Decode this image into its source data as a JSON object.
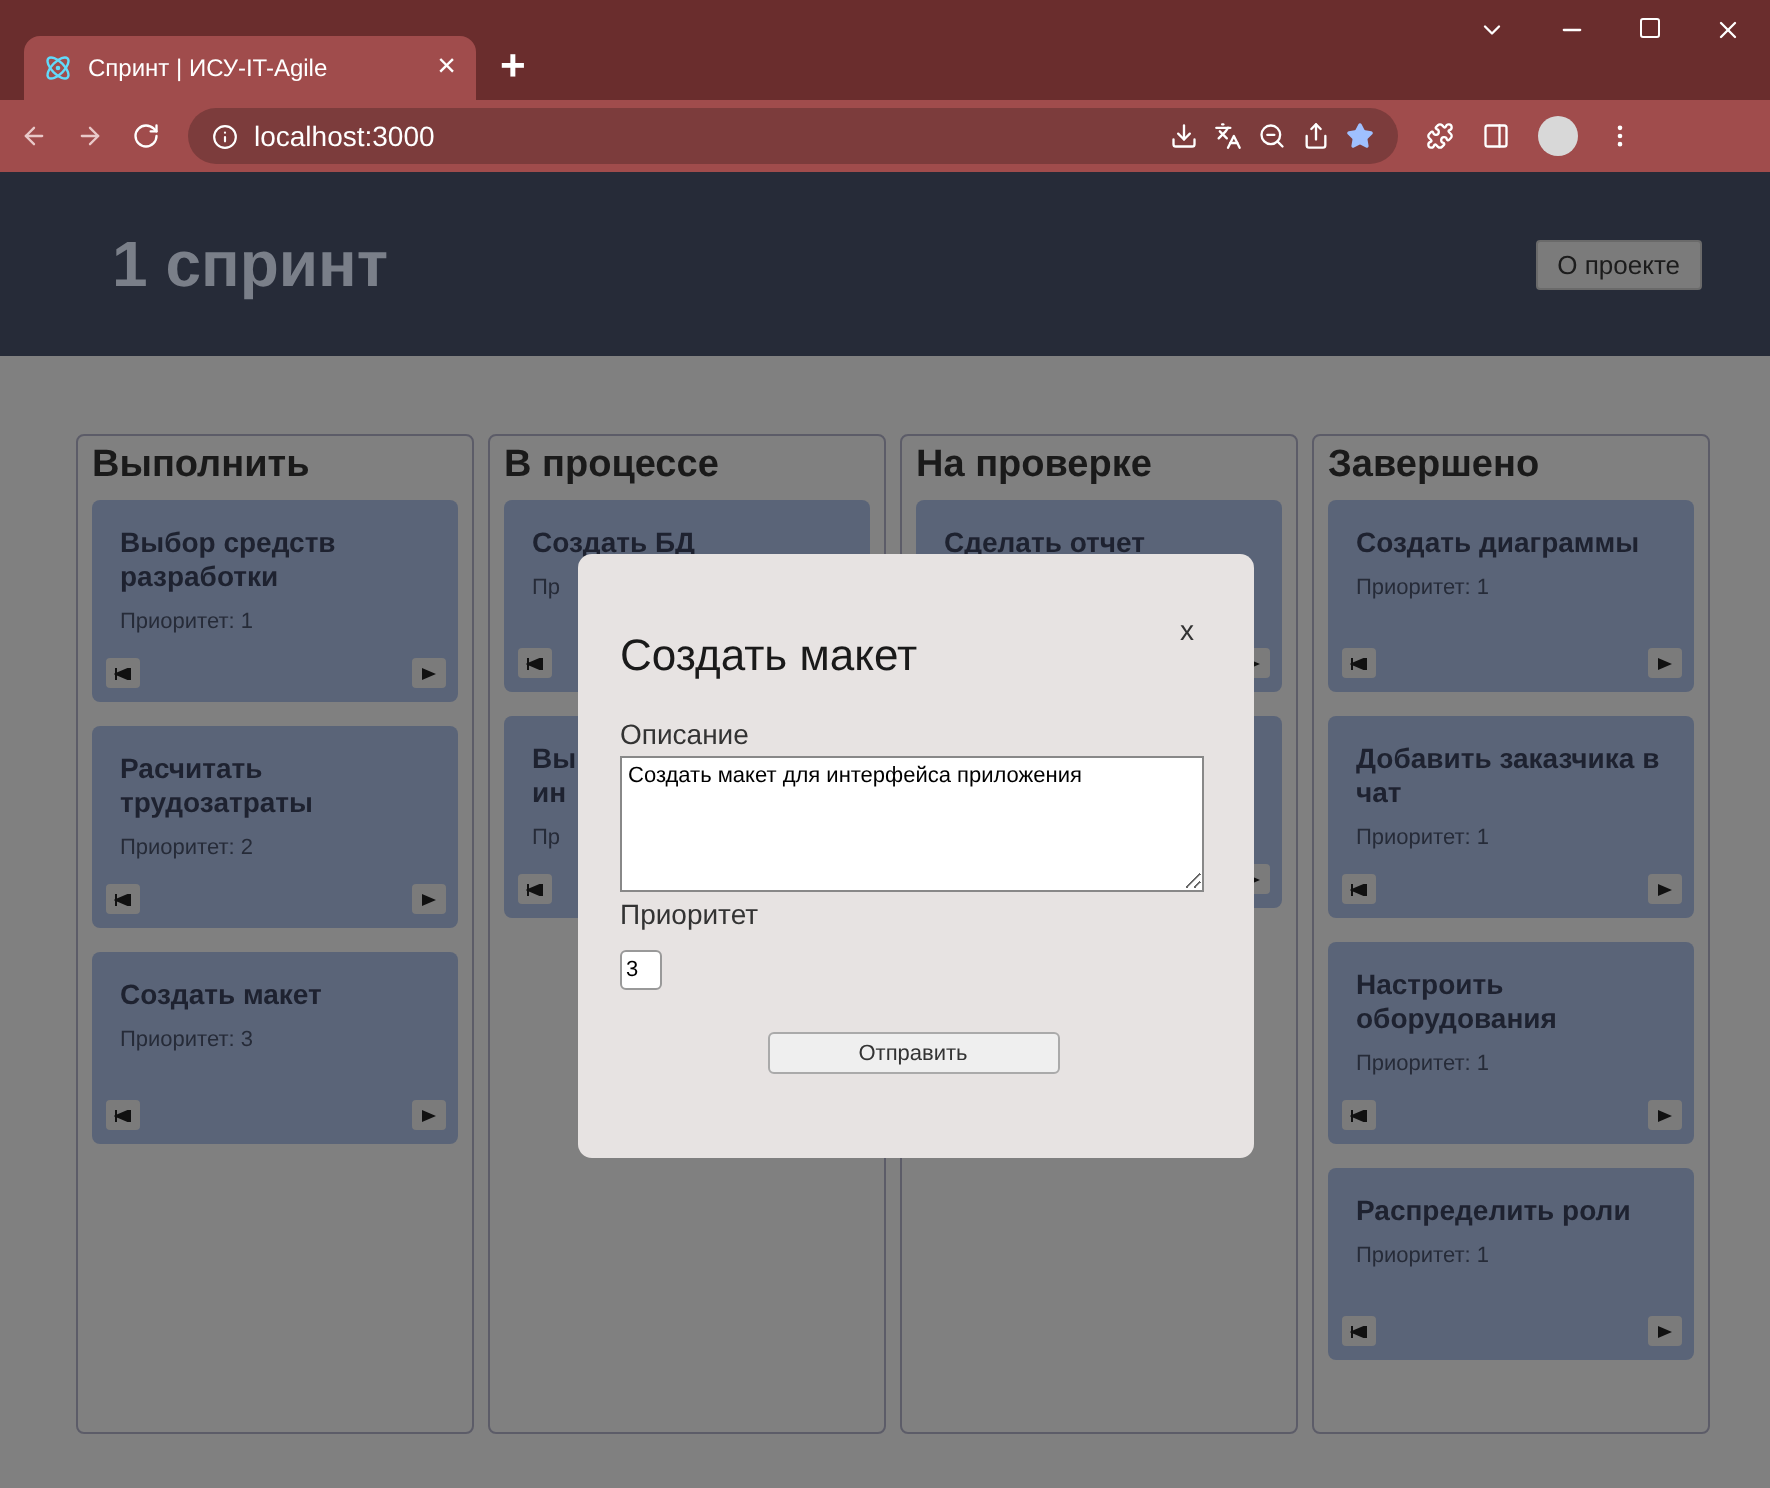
{
  "browser": {
    "tab": {
      "title": "Спринт | ИСУ-IT-Agile",
      "close": "×",
      "selected": true
    },
    "new_tab": "+",
    "address": "localhost:3000"
  },
  "header": {
    "title": "1 спринт",
    "about_button": "О проекте"
  },
  "columns": [
    {
      "title": "Выполнить",
      "cards": [
        {
          "kind": "task",
          "title": "Выбор средств разработки",
          "priority": "Приоритет: 1"
        },
        {
          "kind": "task",
          "title": "Расчитать трудозатраты",
          "priority": "Приоритет: 2"
        },
        {
          "kind": "task",
          "title": "Создать макет",
          "priority": "Приоритет: 3"
        }
      ]
    },
    {
      "title": "В процессе",
      "cards": [
        {
          "kind": "task",
          "title": "Создать БД",
          "priority": "Пр"
        },
        {
          "kind": "task",
          "title": "Вы\nин",
          "priority": "Пр"
        }
      ]
    },
    {
      "title": "На проверке",
      "cards": [
        {
          "kind": "task",
          "title": "Сделать отчет"
        },
        {
          "kind": "task"
        }
      ]
    },
    {
      "title": "Завершено",
      "cards": [
        {
          "kind": "task",
          "title": "Создать диаграммы",
          "priority": "Приоритет: 1"
        },
        {
          "kind": "task",
          "title": "Добавить заказчика в чат",
          "priority": "Приоритет: 1"
        },
        {
          "kind": "task",
          "title": "Настроить оборудования",
          "priority": "Приоритет: 1"
        },
        {
          "kind": "task",
          "title": "Распределить роли",
          "priority": "Приоритет: 1"
        }
      ]
    }
  ],
  "modal": {
    "title": "Создать макет",
    "close": "x",
    "description_label": "Описание",
    "description": "Создать макет для интерфейса приложения",
    "priority_label": "Приоритет",
    "priority": "3",
    "submit": "Отправить"
  }
}
